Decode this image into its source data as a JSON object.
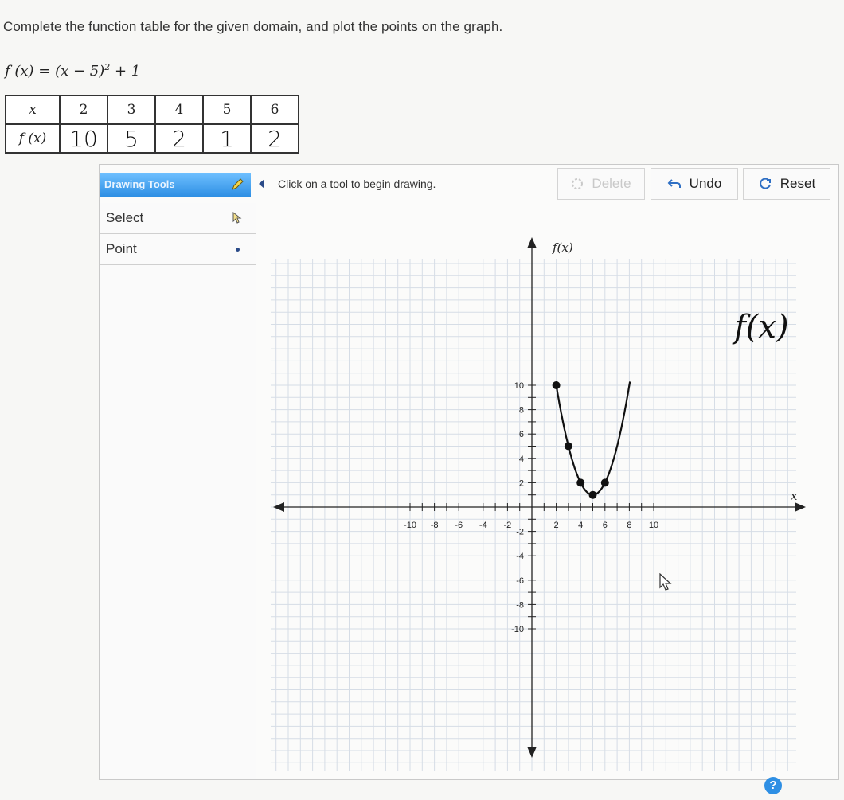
{
  "instruction": "Complete the function table for the given domain, and plot the points on the graph.",
  "formula": {
    "lhs": "f (x) = (x − 5)",
    "exp": "2",
    "rhs": " + 1"
  },
  "table": {
    "x_header": "x",
    "fx_header": "f (x)",
    "x_values": [
      "2",
      "3",
      "4",
      "5",
      "6"
    ],
    "fx_values": [
      "10",
      "5",
      "2",
      "1",
      "2"
    ]
  },
  "toolbar": {
    "title": "Drawing Tools",
    "hint": "Click on a tool to begin drawing.",
    "delete_label": "Delete",
    "undo_label": "Undo",
    "reset_label": "Reset"
  },
  "tools": [
    {
      "label": "Select",
      "icon": "select-cursor-icon"
    },
    {
      "label": "Point",
      "icon": "point-icon"
    }
  ],
  "graph": {
    "x_axis_label": "x",
    "y_axis_label": "f(x)",
    "x_range": [
      -10,
      10
    ],
    "y_range": [
      -10,
      10
    ],
    "x_tick_labels": [
      "-10",
      "-8",
      "-6",
      "-4",
      "-2",
      "2",
      "4",
      "6",
      "8",
      "10"
    ],
    "y_tick_labels": [
      "10",
      "8",
      "6",
      "4",
      "2",
      "-2",
      "-4",
      "-6",
      "-8",
      "-10"
    ],
    "handwritten_label": "f(x)",
    "plotted_points": [
      [
        2,
        10
      ],
      [
        3,
        5
      ],
      [
        4,
        2
      ],
      [
        5,
        1
      ],
      [
        6,
        2
      ]
    ],
    "curve_color": "#111111",
    "grid_color": "#d6dde6"
  },
  "help_label": "?"
}
